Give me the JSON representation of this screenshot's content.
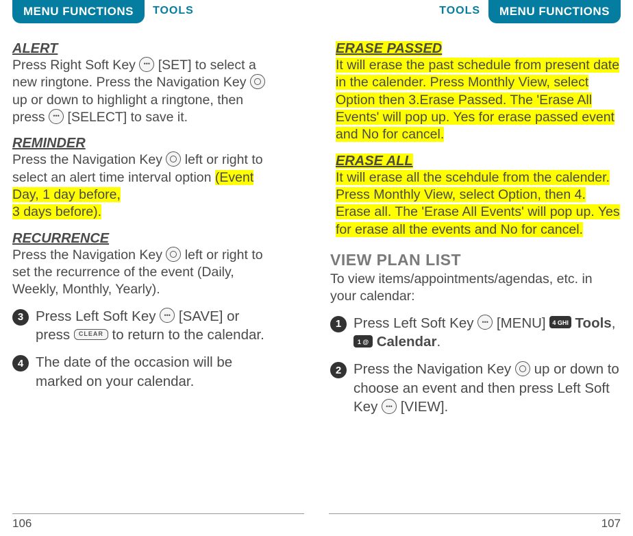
{
  "header": {
    "menuFunctions": "MENU FUNCTIONS",
    "tools": "TOOLS"
  },
  "left": {
    "alert": {
      "title": "ALERT",
      "text_a": "Press Right Soft Key ",
      "text_b": " [SET] to select a new ringtone. Press the Navigation Key ",
      "text_c": " up or down to highlight a ringtone, then press ",
      "text_d": " [SELECT] to save it."
    },
    "reminder": {
      "title": "REMINDER",
      "text_a": "Press the Navigation Key ",
      "text_b": " left or right to select an alert time interval option ",
      "hl_a": "(Event Day, 1 day before,",
      "hl_b": "3 days before)."
    },
    "recurrence": {
      "title": "RECURRENCE",
      "text_a": "Press the Navigation Key ",
      "text_b": " left or right to set the recurrence of the event (Daily, Weekly, Monthly, Yearly)."
    },
    "step3": {
      "num": "3",
      "text_a": "Press Left Soft Key ",
      "text_b": " [SAVE] or press ",
      "clear": "CLEAR",
      "text_c": " to return to the calendar."
    },
    "step4": {
      "num": "4",
      "text": "The date of the occasion will be marked on your calendar."
    },
    "pageNum": "106"
  },
  "right": {
    "erasePassed": {
      "title": "ERASE PASSED",
      "text": "It will erase the past schedule from present date in the calender. Press Monthly View, select Option then 3.Erase Passed. The 'Erase All Events' will pop up. Yes for erase passed event and No for cancel."
    },
    "eraseAll": {
      "title": "ERASE ALL",
      "text": "It will erase all the scehdule from the calender. Press Monthly View, select Option, then 4. Erase all. The 'Erase All Events' will pop up. Yes for erase all the events and No for cancel."
    },
    "viewPlan": {
      "title": "VIEW PLAN LIST",
      "intro": "To view items/appointments/agendas, etc. in your calendar:",
      "step1": {
        "num": "1",
        "text_a": "Press Left Soft Key ",
        "text_b": " [MENU] ",
        "key4": "4 GHI",
        "tools": "Tools",
        "comma": ", ",
        "key1": "1 @",
        "calendar": "Calendar",
        "period": "."
      },
      "step2": {
        "num": "2",
        "text_a": "Press the Navigation Key ",
        "text_b": " up or down to choose an event and then press Left Soft Key ",
        "text_c": " [VIEW]."
      }
    },
    "pageNum": "107"
  }
}
